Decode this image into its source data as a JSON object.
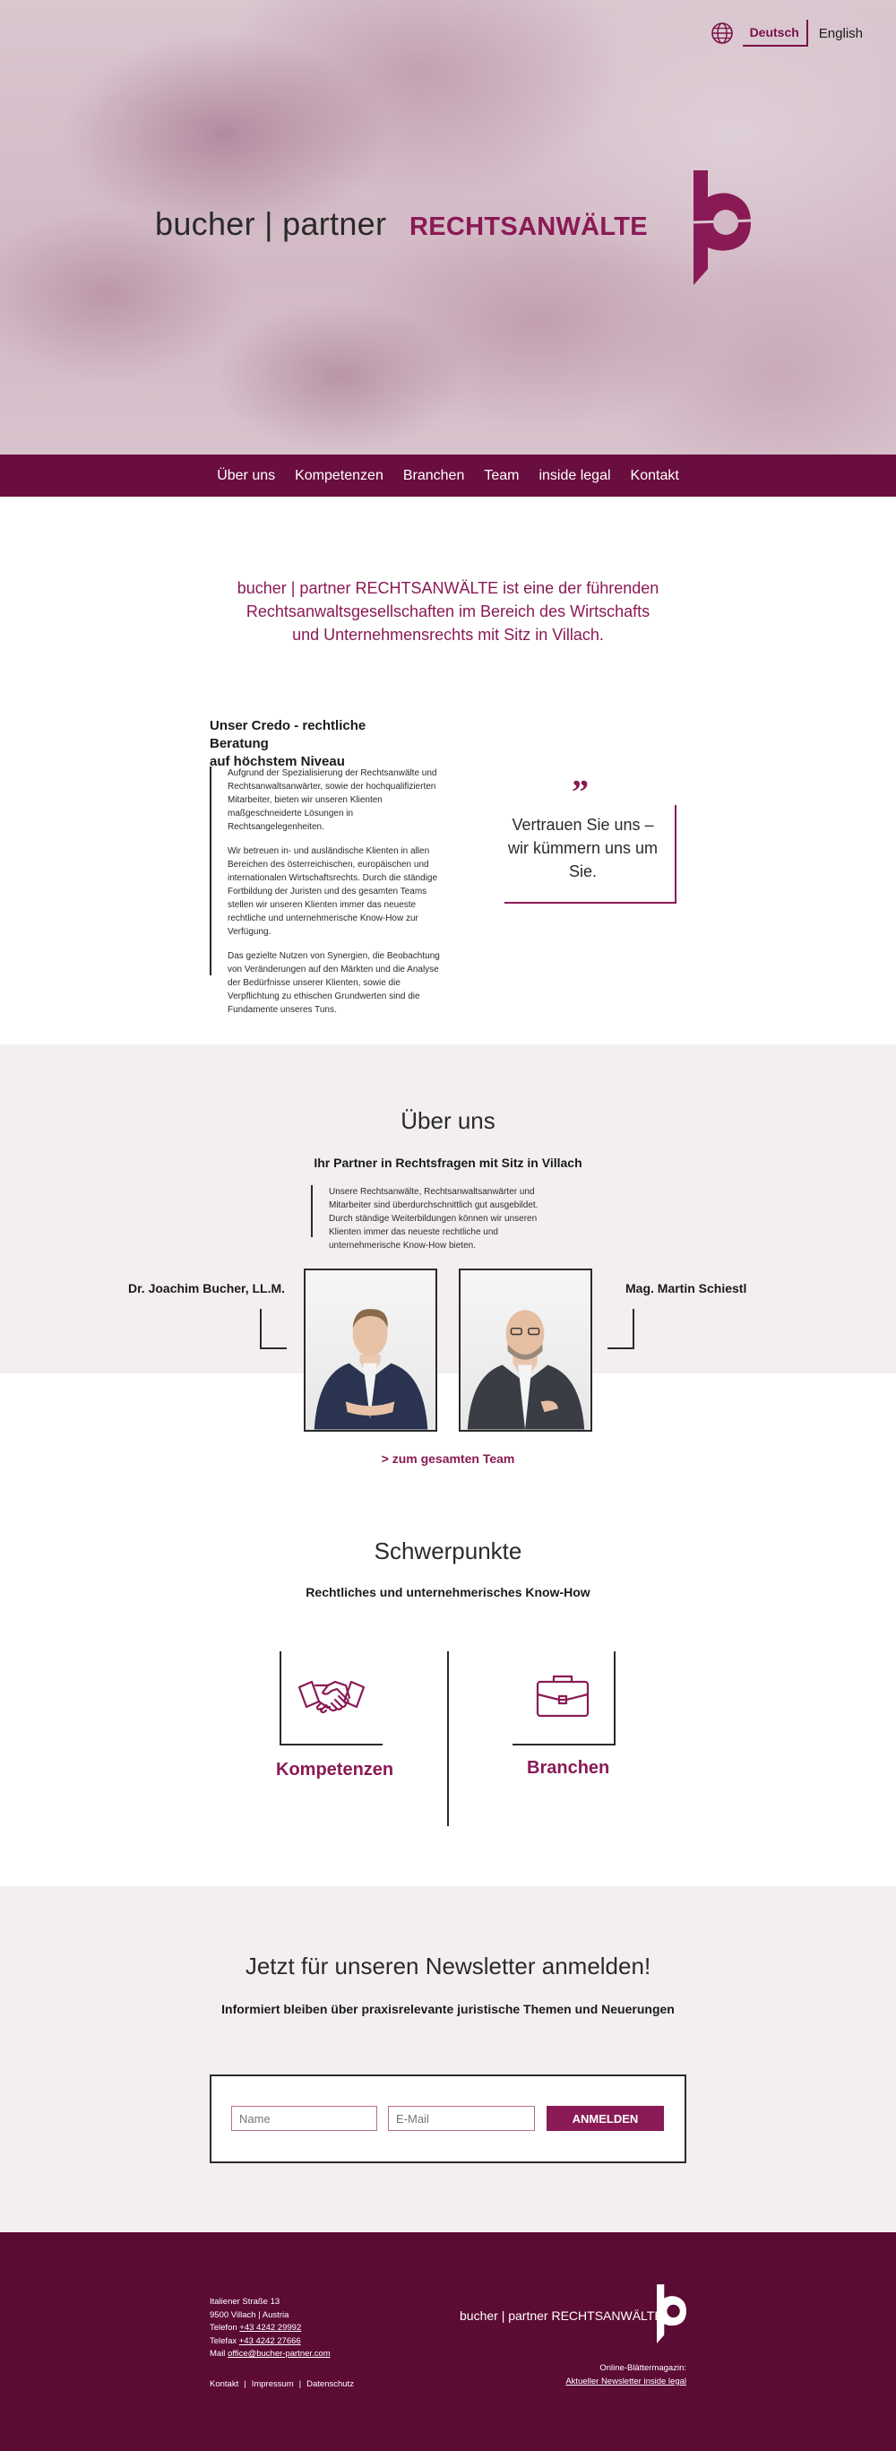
{
  "colors": {
    "accent": "#8a1a55",
    "nav_bg": "#6a0e3f",
    "footer_bg": "#5c0b35",
    "section_bg": "#f3eff1"
  },
  "header": {
    "lang_active": "Deutsch",
    "lang_other": "English",
    "brand_name": "bucher | partner",
    "brand_suffix": "RECHTSANWÄLTE"
  },
  "nav": {
    "items": [
      "Über uns",
      "Kompetenzen",
      "Branchen",
      "Team",
      "inside legal",
      "Kontakt"
    ]
  },
  "intro": {
    "line1": "bucher | partner RECHTSANWÄLTE ist eine der führenden",
    "line2": "Rechtsanwaltsgesellschaften im Bereich des Wirtschafts",
    "line3": "und Unternehmensrechts mit Sitz in Villach."
  },
  "credo": {
    "title_line1": "Unser Credo - rechtliche Beratung",
    "title_line2": "auf höchstem Niveau",
    "p1": "Aufgrund der Spezialisierung der Rechtsanwälte und Rechtsanwaltsanwärter, sowie der hochqualifizierten Mitarbeiter, bieten wir unseren Klienten maßgeschneiderte Lösungen in Rechtsangelegenheiten.",
    "p2": "Wir betreuen in- und ausländische Klienten in allen Bereichen des österreichischen, europäischen und internationalen Wirtschaftsrechts. Durch die ständige Fortbildung der Juristen und des gesamten Teams stellen wir unseren Klienten immer das neueste rechtliche und unternehmerische Know-How zur Verfügung.",
    "p3": "Das gezielte Nutzen von Synergien, die Beobachtung von Veränderungen auf den Märkten und die Analyse der Bedürfnisse unserer Klienten, sowie die Verpflichtung zu ethischen Grundwerten sind die Fundamente unseres Tuns.",
    "quote_mark": "”",
    "quote": "Vertrauen Sie uns – wir kümmern uns um Sie."
  },
  "about": {
    "title": "Über uns",
    "subtitle": "Ihr Partner in Rechtsfragen mit Sitz in Villach",
    "body": "Unsere Rechtsanwälte, Rechtsanwaltsanwärter und Mitarbeiter sind überdurchschnittlich gut ausgebildet. Durch ständige Weiterbildungen können wir unseren Klienten immer das neueste rechtliche und unternehmerische Know-How bieten.",
    "person_left": "Dr. Joachim Bucher, LL.M.",
    "person_right": "Mag. Martin Schiestl",
    "team_link": "> zum gesamten Team"
  },
  "focus": {
    "title": "Schwerpunkte",
    "subtitle": "Rechtliches und unternehmerisches Know-How",
    "left_label": "Kompetenzen",
    "left_icon": "handshake-icon",
    "right_label": "Branchen",
    "right_icon": "briefcase-icon"
  },
  "newsletter": {
    "title": "Jetzt für unseren Newsletter anmelden!",
    "subtitle": "Informiert bleiben über praxisrelevante juristische Themen und Neuerungen",
    "name_placeholder": "Name",
    "email_placeholder": "E-Mail",
    "button": "ANMELDEN"
  },
  "footer": {
    "street": "Italiener Straße 13",
    "city": "9500 Villach | Austria",
    "phone_label": "Telefon",
    "phone": "+43 4242 29992",
    "fax_label": "Telefax",
    "fax": "+43 4242 27666",
    "mail_label": "Mail",
    "mail": "office@bucher-partner.com",
    "links": [
      "Kontakt",
      "Impressum",
      "Datenschutz"
    ],
    "separator": "|",
    "brand": "bucher | partner RECHTSANWÄLTE",
    "mag_label": "Online-Blättermagazin:",
    "mag_link": "Aktueller Newsletter inside legal"
  }
}
